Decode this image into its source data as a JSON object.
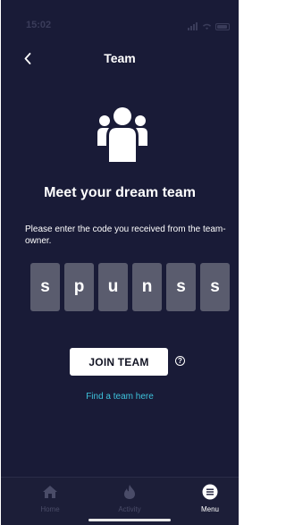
{
  "status": {
    "time": "15:02"
  },
  "nav": {
    "title": "Team",
    "back_icon": "chevron-left-icon"
  },
  "hero": {
    "icon": "team-icon",
    "heading": "Meet your dream team"
  },
  "instructions": "Please enter the code you received from the team-owner.",
  "code": [
    "s",
    "p",
    "u",
    "n",
    "s",
    "s"
  ],
  "join_button": "JOIN TEAM",
  "help_icon": "?",
  "find_link": "Find a team here",
  "tabs": [
    {
      "label": "Home",
      "icon": "home-icon",
      "active": false
    },
    {
      "label": "Activity",
      "icon": "flame-icon",
      "active": false
    },
    {
      "label": "Menu",
      "icon": "menu-icon",
      "active": true
    }
  ],
  "colors": {
    "background": "#191b37",
    "code_box": "#5a5c6e",
    "link": "#3ec3dc",
    "inactive_tab": "#4a4c68"
  }
}
